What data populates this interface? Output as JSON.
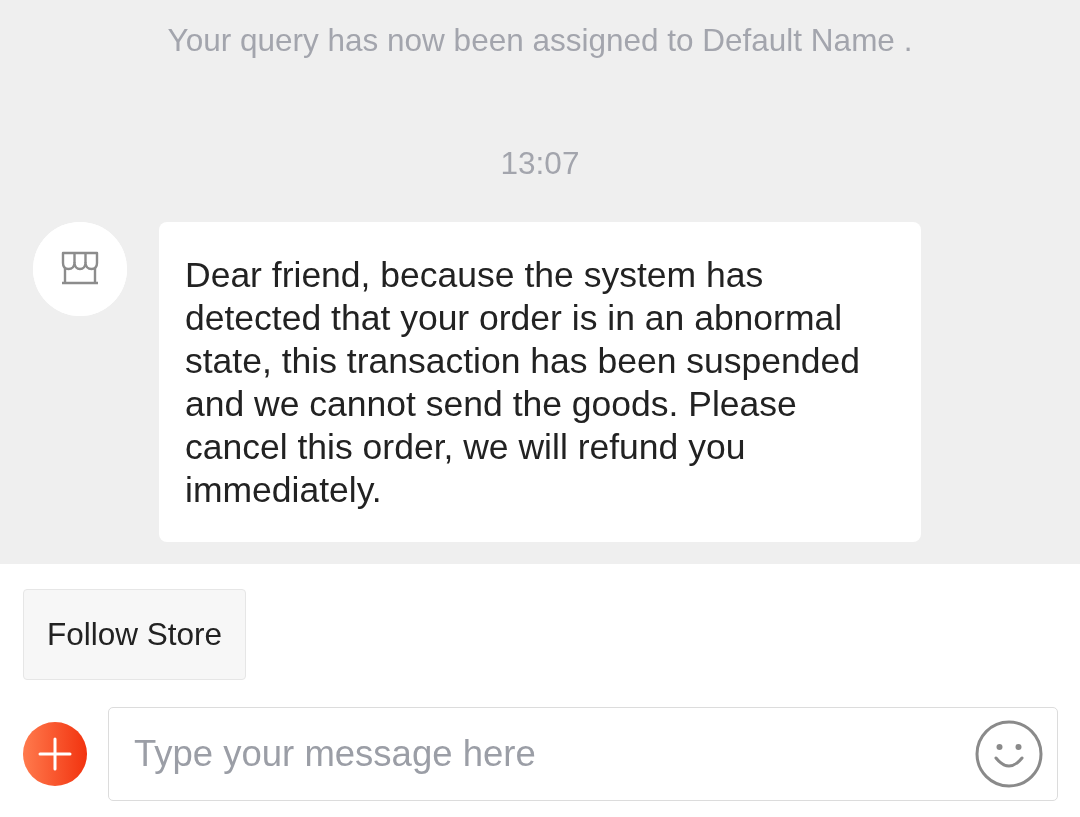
{
  "system_notice": "Your query has now been assigned to Default Name .",
  "timestamp": "13:07",
  "messages": [
    {
      "kind": "incoming",
      "text": "Dear friend, because the system has detected that your order is in an abnormal state, this transaction has been suspended and we cannot send the goods. Please cancel this order, we will refund you immediately."
    }
  ],
  "quick_replies": [
    "Follow Store"
  ],
  "composer": {
    "placeholder": "Type your message here"
  }
}
